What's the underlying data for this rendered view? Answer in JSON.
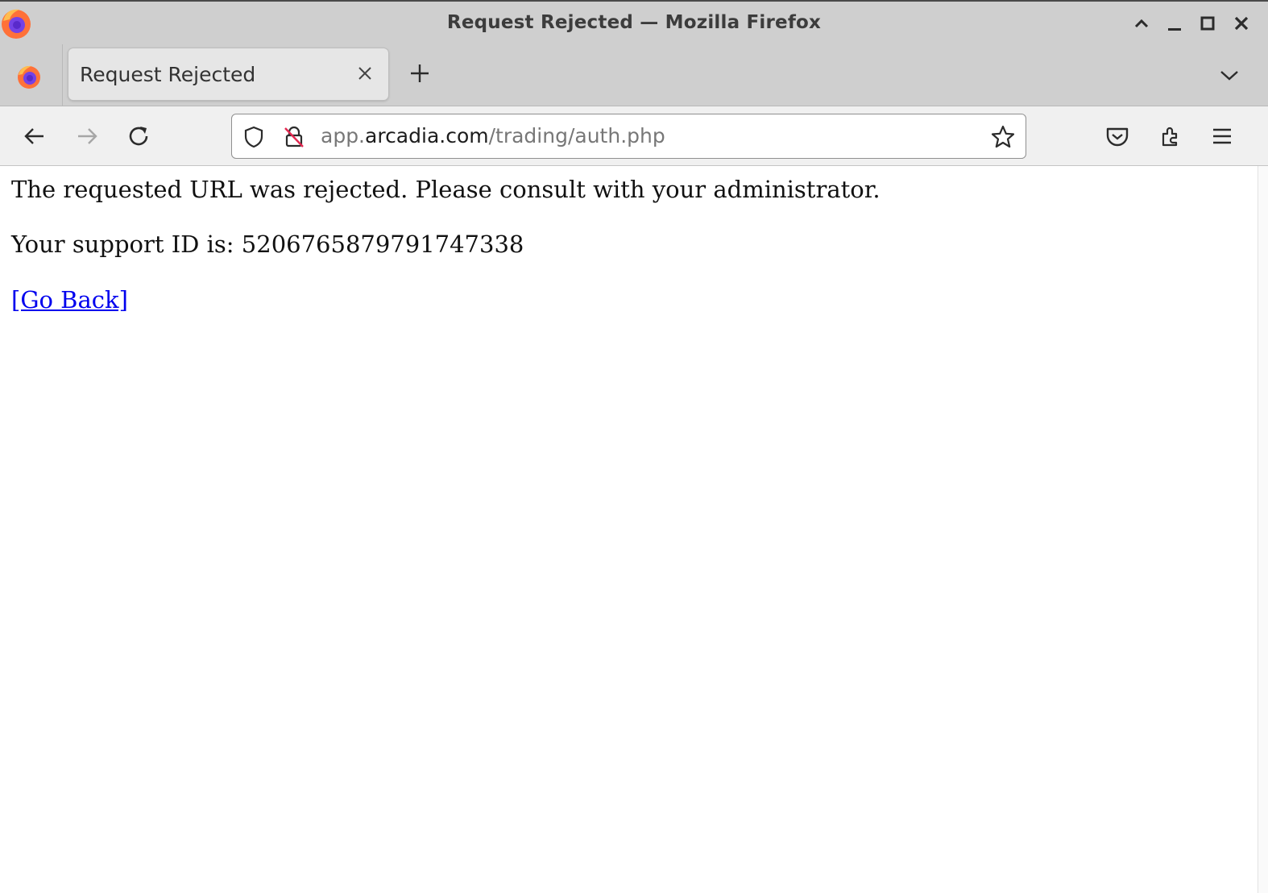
{
  "window": {
    "title": "Request Rejected — Mozilla Firefox",
    "buttons": [
      "maximize-up",
      "minimize",
      "restore",
      "close"
    ]
  },
  "tabs": [
    {
      "label": "Request Rejected",
      "active": true
    }
  ],
  "navbar": {
    "url_prefix": "app.",
    "url_host": "arcadia.com",
    "url_path": "/trading/auth.php"
  },
  "page": {
    "message": "The requested URL was rejected. Please consult with your administrator.",
    "support_id_line": "Your support ID is: 5206765879791747338",
    "go_back_label": "[Go Back]"
  },
  "colors": {
    "chrome": "#cfcfcf",
    "navbar": "#f0f0f0",
    "link": "#0000ee",
    "firefox_orange": "#ff7139",
    "firefox_purple": "#7542e5"
  }
}
